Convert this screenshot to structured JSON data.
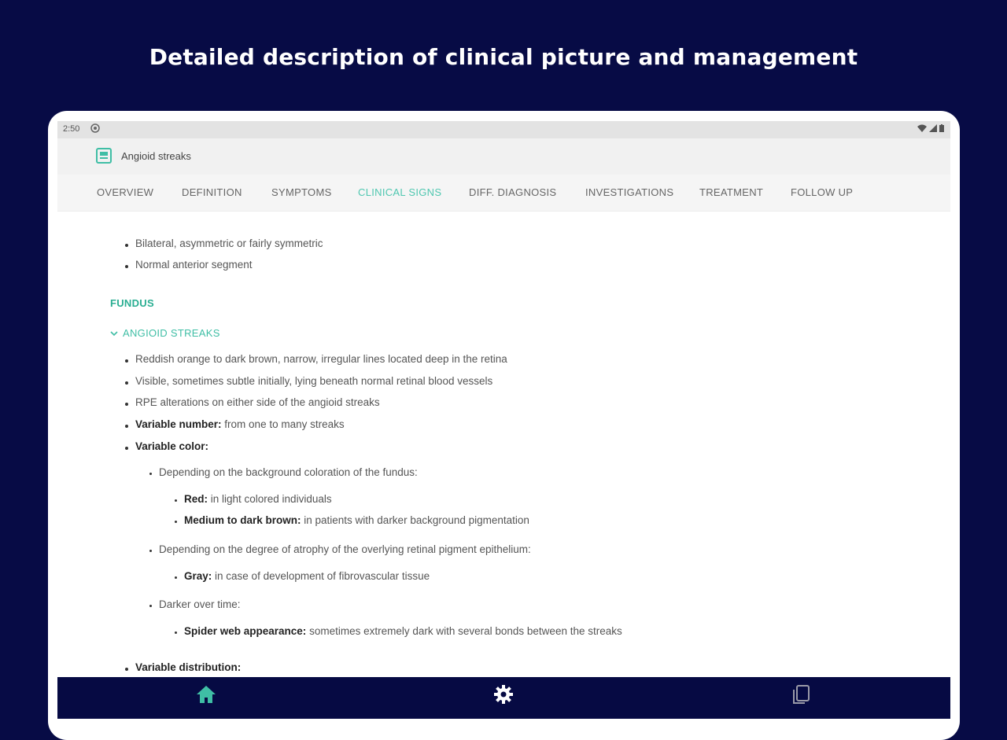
{
  "headline": "Detailed description of clinical picture and management",
  "status_bar": {
    "time": "2:50"
  },
  "app_bar": {
    "title": "Angioid streaks"
  },
  "tabs": [
    {
      "label": "OVERVIEW",
      "active": false
    },
    {
      "label": "DEFINITION",
      "active": false
    },
    {
      "label": "SYMPTOMS",
      "active": false
    },
    {
      "label": "CLINICAL SIGNS",
      "active": true
    },
    {
      "label": "DIFF. DIAGNOSIS",
      "active": false
    },
    {
      "label": "INVESTIGATIONS",
      "active": false
    },
    {
      "label": "TREATMENT",
      "active": false
    },
    {
      "label": "FOLLOW UP",
      "active": false
    }
  ],
  "content": {
    "intro_items": [
      {
        "bold": "",
        "text": "Bilateral, asymmetric or fairly symmetric"
      },
      {
        "bold": "",
        "text": "Normal anterior segment"
      }
    ],
    "section_title": "FUNDUS",
    "subsection_title": "ANGIOID STREAKS",
    "items": [
      {
        "bold": "",
        "text": "Reddish orange to dark brown, narrow, irregular lines located deep in the retina"
      },
      {
        "bold": "",
        "text": "Visible, sometimes subtle initially, lying beneath normal retinal blood vessels"
      },
      {
        "bold": "",
        "text": "RPE alterations on either side of the angioid streaks"
      },
      {
        "bold": "Variable number:",
        "text": " from one to many streaks"
      },
      {
        "bold": "Variable color:",
        "text": ""
      }
    ],
    "color_subitems": [
      {
        "text": "Depending on the background coloration of the fundus:"
      },
      {
        "bold": "Red:",
        "text": " in light colored individuals"
      },
      {
        "bold": "Medium to dark brown:",
        "text": " in patients with darker background pigmentation"
      },
      {
        "text": "Depending on the degree of atrophy of the overlying retinal pigment epithelium:"
      },
      {
        "bold": "Gray:",
        "text": " in case of development of fibrovascular tissue"
      },
      {
        "text": "Darker over time:"
      },
      {
        "bold": "Spider web appearance:",
        "text": " sometimes extremely dark with several bonds between the streaks"
      }
    ],
    "last_item": {
      "bold": "Variable distribution:",
      "text": ""
    }
  },
  "colors": {
    "accent": "#4fc7b0",
    "background": "#070b45",
    "navbar": "#060a43"
  },
  "bottom_nav": [
    {
      "icon": "home-icon",
      "active": true
    },
    {
      "icon": "gear-icon",
      "active": false
    },
    {
      "icon": "pages-icon",
      "active": false
    }
  ]
}
